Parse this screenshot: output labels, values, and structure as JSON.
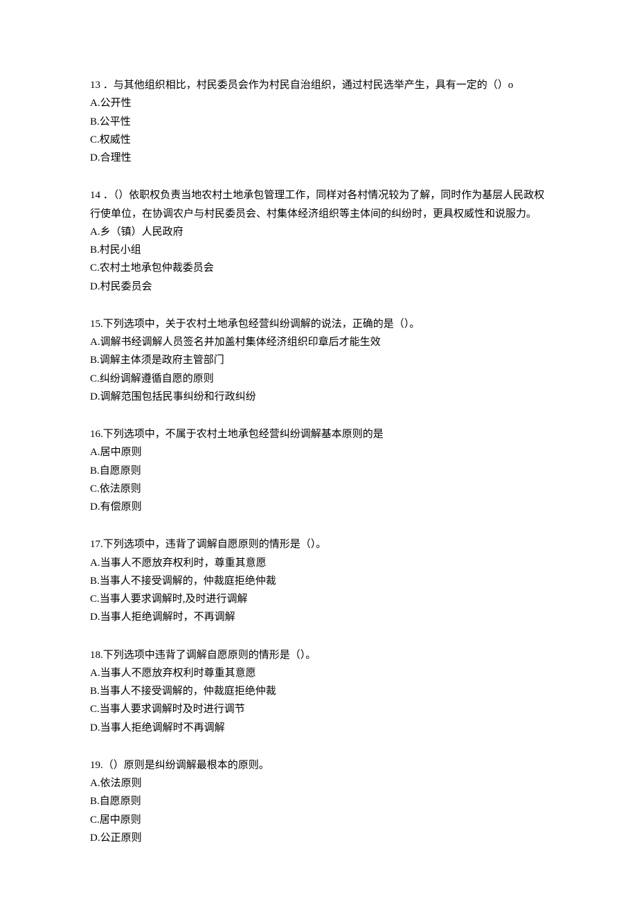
{
  "questions": [
    {
      "number": "13",
      "stem": " ．与其他组织相比，村民委员会作为村民自治组织，通过村民选举产生，具有一定的（）o",
      "options": [
        "A.公开性",
        "B.公平性",
        "C.权威性",
        "D.合理性"
      ]
    },
    {
      "number": "14",
      "stem": " ．（）依职权负责当地农村土地承包管理工作，同样对各村情况较为了解，同时作为基层人民政权行使单位，在协调农户与村民委员会、村集体经济组织等主体间的纠纷时，更具权威性和说服力。",
      "options": [
        "A.乡（镇）人民政府",
        "B.村民小组",
        "C.农村土地承包仲裁委员会",
        "D.村民委员会"
      ]
    },
    {
      "number": "15.",
      "stem": "下列选项中，关于农村土地承包经营纠纷调解的说法，正确的是（）。",
      "options": [
        "A.调解书经调解人员签名并加盖村集体经济组织印章后才能生效",
        "B.调解主体须是政府主管部门",
        "C.纠纷调解遵循自愿的原则",
        "D.调解范围包括民事纠纷和行政纠纷"
      ]
    },
    {
      "number": "16.",
      "stem": "下列选项中，不属于农村土地承包经营纠纷调解基本原则的是",
      "options": [
        "A.居中原则",
        "B.自愿原则",
        "C.依法原则",
        "D.有偿原则"
      ]
    },
    {
      "number": "17.",
      "stem": "下列选项中，违背了调解自愿原则的情形是（）。",
      "options": [
        "A.当事人不愿放弃权利时，尊重其意愿",
        "B.当事人不接受调解的，仲裁庭拒绝仲裁",
        "C.当事人要求调解时,及时进行调解",
        "D.当事人拒绝调解时，不再调解"
      ]
    },
    {
      "number": "18.",
      "stem": "下列选项中违背了调解自愿原则的情形是（）。",
      "options": [
        "A.当事人不愿放弃权利时尊重其意愿",
        "B.当事人不接受调解的，仲裁庭拒绝仲裁",
        "C.当事人要求调解时及时进行调节",
        "D.当事人拒绝调解时不再调解"
      ]
    },
    {
      "number": "19.",
      "stem": "（）原则是纠纷调解最根本的原则。",
      "options": [
        "A.依法原则",
        "B.自愿原则",
        "C.居中原则",
        "D.公正原则"
      ]
    }
  ]
}
